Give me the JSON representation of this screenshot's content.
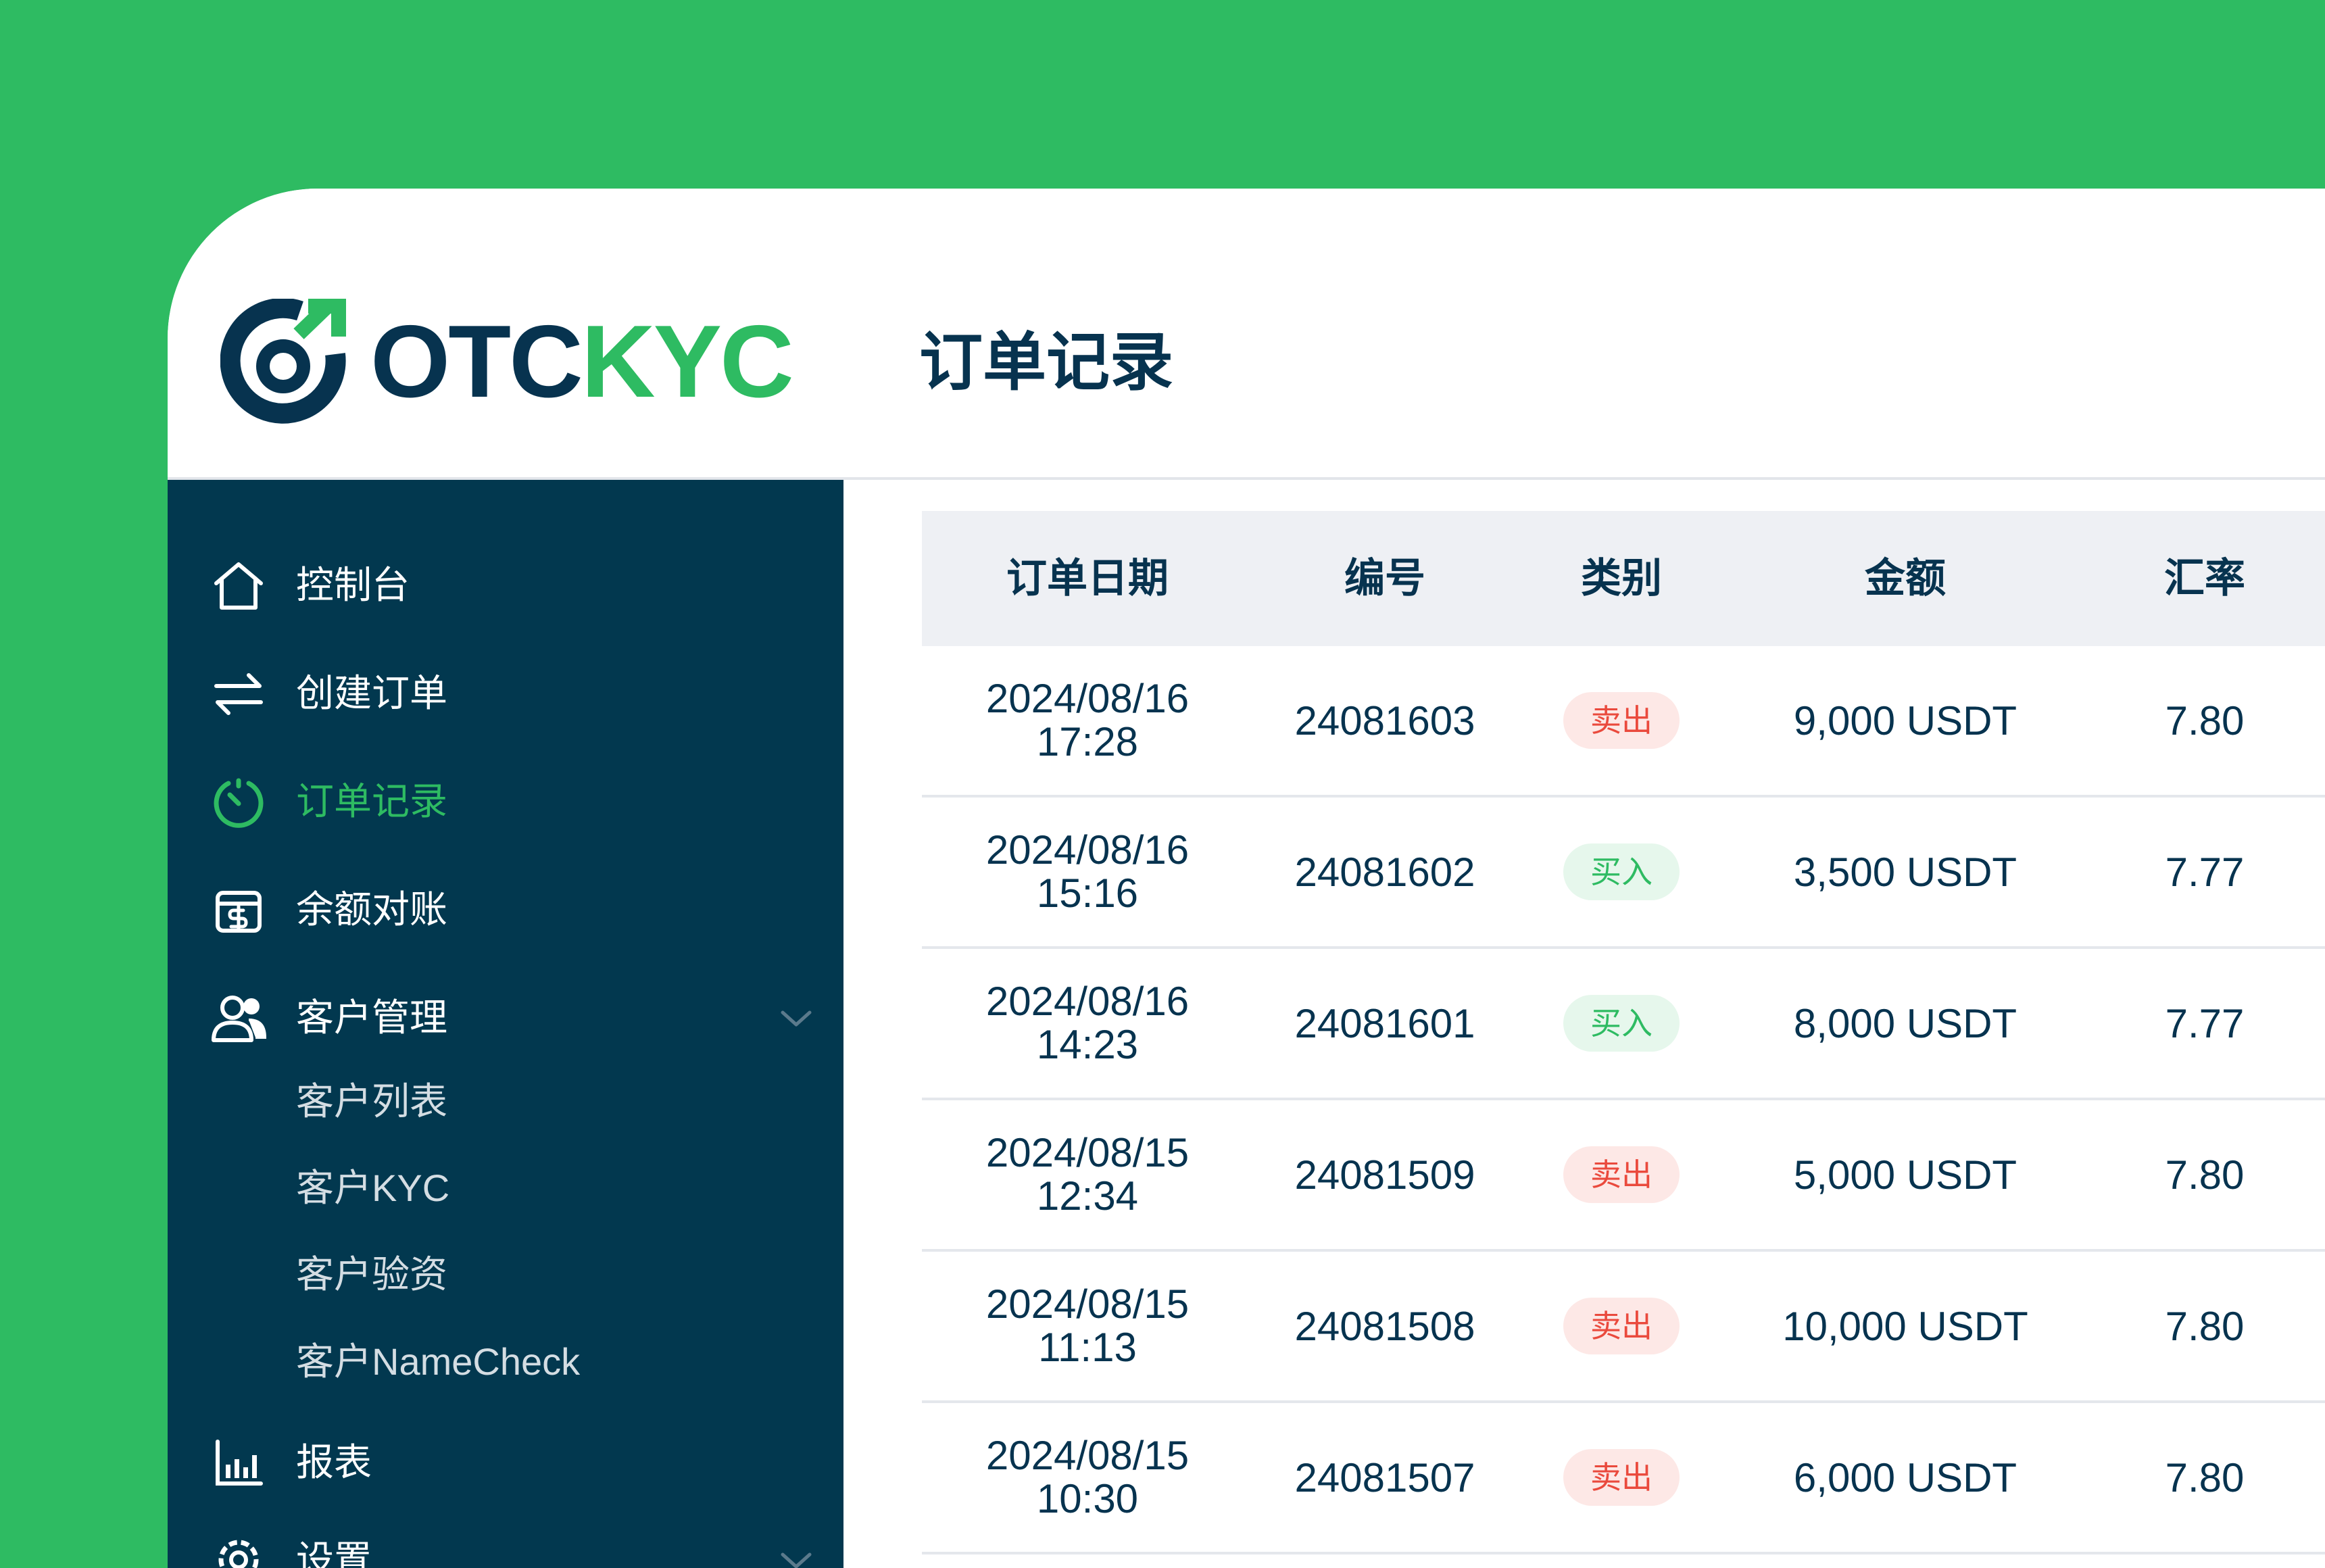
{
  "app": {
    "logo_text_dark": "OTC",
    "logo_text_accent": "KYC",
    "page_title": "订单记录",
    "colors": {
      "brand_green": "#2ebb62",
      "navy": "#07334f",
      "sidebar_bg": "#02384f",
      "sell_red": "#ea4a3d"
    }
  },
  "sidebar": {
    "items": [
      {
        "label": "控制台",
        "icon": "home-icon"
      },
      {
        "label": "创建订单",
        "icon": "swap-arrows-icon"
      },
      {
        "label": "订单记录",
        "icon": "history-clock-icon",
        "active": true
      },
      {
        "label": "余额对账",
        "icon": "wallet-dollar-icon"
      },
      {
        "label": "客户管理",
        "icon": "users-icon",
        "expanded": true
      },
      {
        "label": "报表",
        "icon": "bar-chart-icon"
      },
      {
        "label": "设置",
        "icon": "gear-icon"
      }
    ],
    "sub_items": [
      {
        "label": "客户列表"
      },
      {
        "label": "客户KYC"
      },
      {
        "label": "客户验资"
      },
      {
        "label": "客户NameCheck"
      }
    ]
  },
  "table": {
    "headers": {
      "date": "订单日期",
      "number": "编号",
      "type": "类别",
      "amount": "金额",
      "rate": "汇率"
    },
    "rows": [
      {
        "date": "2024/08/16",
        "time": "17:28",
        "number": "24081603",
        "type": "卖出",
        "amount": "9,000 USDT",
        "rate": "7.80"
      },
      {
        "date": "2024/08/16",
        "time": "15:16",
        "number": "24081602",
        "type": "买入",
        "amount": "3,500 USDT",
        "rate": "7.77"
      },
      {
        "date": "2024/08/16",
        "time": "14:23",
        "number": "24081601",
        "type": "买入",
        "amount": "8,000 USDT",
        "rate": "7.77"
      },
      {
        "date": "2024/08/15",
        "time": "12:34",
        "number": "24081509",
        "type": "卖出",
        "amount": "5,000 USDT",
        "rate": "7.80"
      },
      {
        "date": "2024/08/15",
        "time": "11:13",
        "number": "24081508",
        "type": "卖出",
        "amount": "10,000 USDT",
        "rate": "7.80"
      },
      {
        "date": "2024/08/15",
        "time": "10:30",
        "number": "24081507",
        "type": "卖出",
        "amount": "6,000 USDT",
        "rate": "7.80"
      }
    ]
  }
}
